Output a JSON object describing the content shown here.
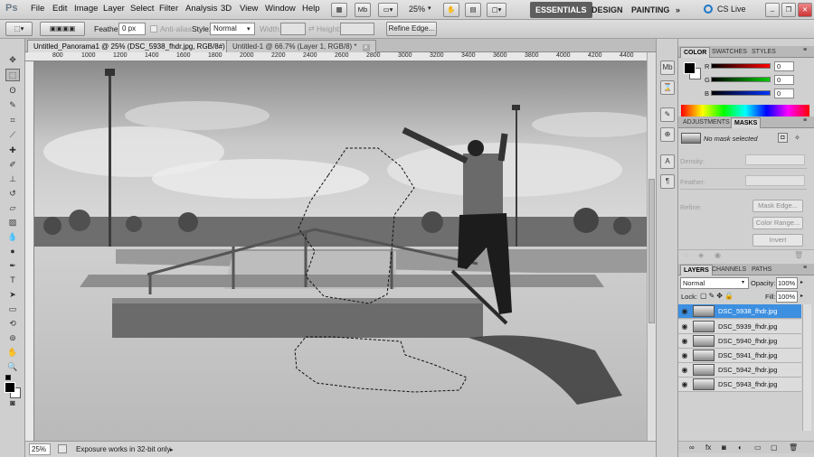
{
  "app": {
    "logo": "Ps"
  },
  "menu": [
    "File",
    "Edit",
    "Image",
    "Layer",
    "Select",
    "Filter",
    "Analysis",
    "3D",
    "View",
    "Window",
    "Help"
  ],
  "appbar": {
    "zoom": "25%",
    "mb_label": "Mb"
  },
  "workspaces": [
    "ESSENTIALS",
    "DESIGN",
    "PAINTING"
  ],
  "workspace_more": "»",
  "cs_live": "CS Live",
  "options": {
    "feather_label": "Feather:",
    "feather_value": "0 px",
    "antialias_label": "Anti-alias",
    "style_label": "Style:",
    "style_value": "Normal",
    "width_label": "Width:",
    "height_label": "Height:",
    "refine_edge": "Refine Edge..."
  },
  "tabs": [
    {
      "label": "Untitled_Panorama1 @ 25% (DSC_5938_fhdr.jpg, RGB/8#) *"
    },
    {
      "label": "Untitled-1 @ 66.7% (Layer 1, RGB/8) *"
    }
  ],
  "ruler_ticks": [
    "800",
    "1000",
    "1200",
    "1400",
    "1600",
    "1800",
    "2000",
    "2200",
    "2400",
    "2600",
    "2800",
    "3000",
    "3200",
    "3400",
    "3600",
    "3800",
    "4000",
    "4200",
    "4400"
  ],
  "status": {
    "zoom": "25%",
    "message": "Exposure works in 32-bit only"
  },
  "color_panel": {
    "tabs": [
      "COLOR",
      "SWATCHES",
      "STYLES"
    ],
    "channels": [
      {
        "label": "R",
        "value": "0",
        "color": "#d01010"
      },
      {
        "label": "G",
        "value": "0",
        "color": "#10a010"
      },
      {
        "label": "B",
        "value": "0",
        "color": "#1030d0"
      }
    ]
  },
  "adjust_panel": {
    "tabs": [
      "ADJUSTMENTS",
      "MASKS"
    ],
    "mask_status": "No mask selected",
    "density_label": "Density:",
    "feather_label": "Feather:",
    "refine_label": "Refine:",
    "buttons": [
      "Mask Edge...",
      "Color Range...",
      "Invert"
    ]
  },
  "layers_panel": {
    "tabs": [
      "LAYERS",
      "CHANNELS",
      "PATHS"
    ],
    "blend_mode": "Normal",
    "opacity_label": "Opacity:",
    "opacity_value": "100%",
    "lock_label": "Lock:",
    "fill_label": "Fill:",
    "fill_value": "100%",
    "layers": [
      {
        "name": "DSC_5938_fhdr.jpg",
        "selected": true
      },
      {
        "name": "DSC_5939_fhdr.jpg",
        "selected": false
      },
      {
        "name": "DSC_5940_fhdr.jpg",
        "selected": false
      },
      {
        "name": "DSC_5941_fhdr.jpg",
        "selected": false
      },
      {
        "name": "DSC_5942_fhdr.jpg",
        "selected": false
      },
      {
        "name": "DSC_5943_fhdr.jpg",
        "selected": false
      }
    ]
  }
}
